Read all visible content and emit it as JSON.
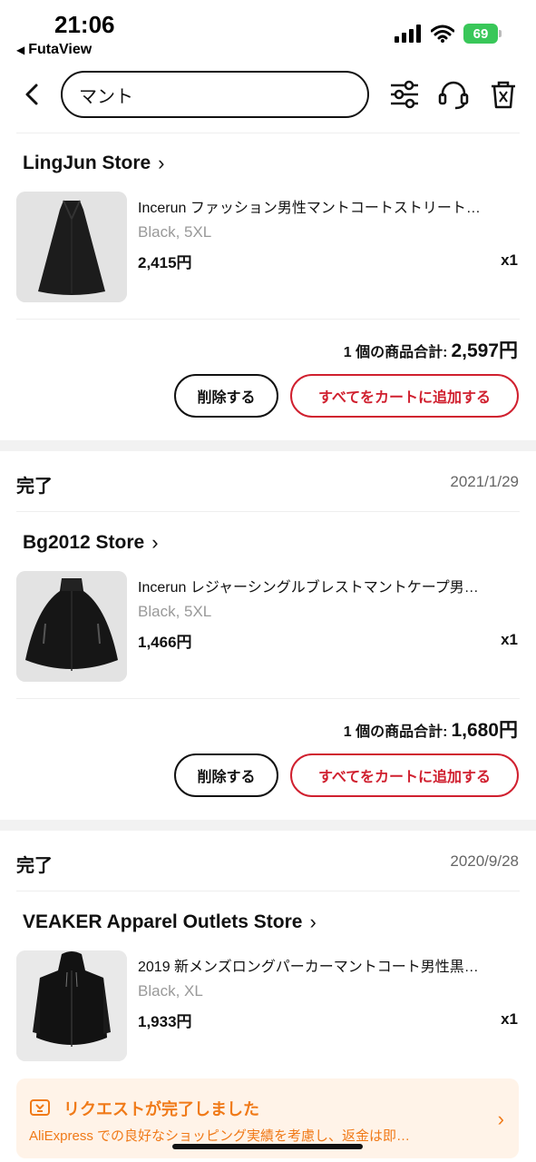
{
  "status_bar": {
    "time": "21:06",
    "back_app": "FutaView",
    "battery": "69"
  },
  "search": {
    "query": "マント"
  },
  "icons": {
    "back": "chevron-left-icon",
    "filter": "sliders-icon",
    "support": "headset-icon",
    "delete": "trash-icon"
  },
  "orders": [
    {
      "store": "LingJun Store",
      "product": {
        "title": "Incerun ファッション男性マントコートストリート…",
        "variant": "Black, 5XL",
        "price": "2,415円",
        "qty": "x1"
      },
      "total_label": "1 個の商品合計:",
      "total_amount": "2,597円",
      "delete_label": "削除する",
      "add_all_label": "すべてをカートに追加する"
    },
    {
      "status": "完了",
      "date": "2021/1/29",
      "store": "Bg2012 Store",
      "product": {
        "title": "Incerun レジャーシングルブレストマントケープ男…",
        "variant": "Black, 5XL",
        "price": "1,466円",
        "qty": "x1"
      },
      "total_label": "1 個の商品合計:",
      "total_amount": "1,680円",
      "delete_label": "削除する",
      "add_all_label": "すべてをカートに追加する"
    },
    {
      "status": "完了",
      "date": "2020/9/28",
      "store": "VEAKER Apparel Outlets Store",
      "product": {
        "title": "2019 新メンズロングパーカーマントコート男性黒…",
        "variant": "Black, XL",
        "price": "1,933円",
        "qty": "x1"
      }
    }
  ],
  "banner": {
    "title": "リクエストが完了しました",
    "text": "AliExpress での良好なショッピング実績を考慮し、返金は即…"
  },
  "colors": {
    "accent_red": "#d0202f",
    "banner_orange": "#f07a18",
    "banner_bg": "#fff3e8"
  }
}
